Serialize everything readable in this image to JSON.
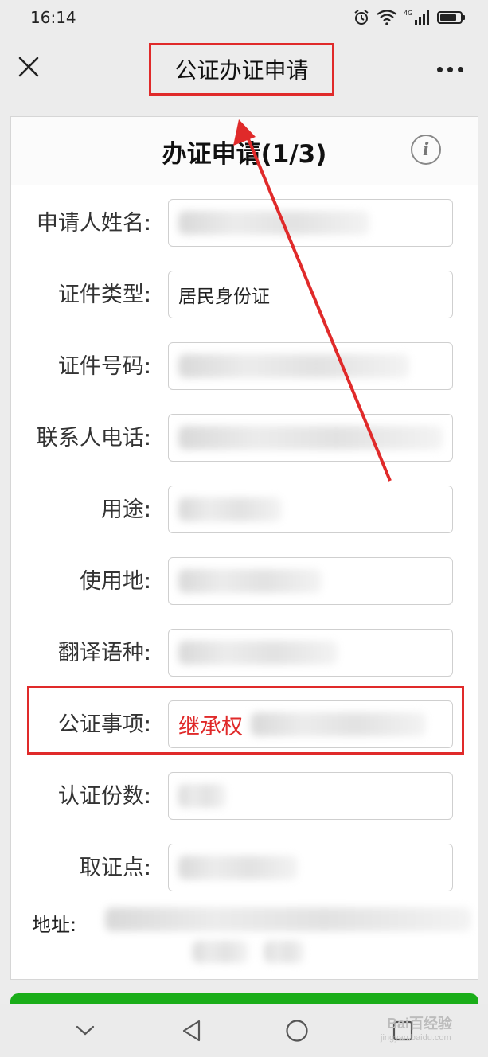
{
  "status_bar": {
    "time": "16:14",
    "network": "4G",
    "icons": [
      "alarm-icon",
      "wifi-icon",
      "signal-icon",
      "battery-icon"
    ]
  },
  "nav": {
    "title": "公证办证申请",
    "close_icon": "close-icon",
    "more_icon": "more-icon"
  },
  "form": {
    "title": "办证申请(1/3)",
    "info_icon": "i",
    "fields": [
      {
        "label": "申请人姓名:",
        "value": ""
      },
      {
        "label": "证件类型:",
        "value": "居民身份证"
      },
      {
        "label": "证件号码:",
        "value": ""
      },
      {
        "label": "联系人电话:",
        "value": ""
      },
      {
        "label": "用途:",
        "value": ""
      },
      {
        "label": "使用地:",
        "value": ""
      },
      {
        "label": "翻译语种:",
        "value": ""
      },
      {
        "label": "公证事项:",
        "value": "继承权"
      },
      {
        "label": "认证份数:",
        "value": ""
      },
      {
        "label": "取证点:",
        "value": ""
      }
    ],
    "address_label": "地址:"
  },
  "annotation": {
    "color": "#e02a2a"
  },
  "watermark": {
    "text": "Bai百经验",
    "url": "jingyan.baidu.com"
  },
  "colors": {
    "accent_green": "#1aad19",
    "annotation_red": "#e02a2a"
  }
}
